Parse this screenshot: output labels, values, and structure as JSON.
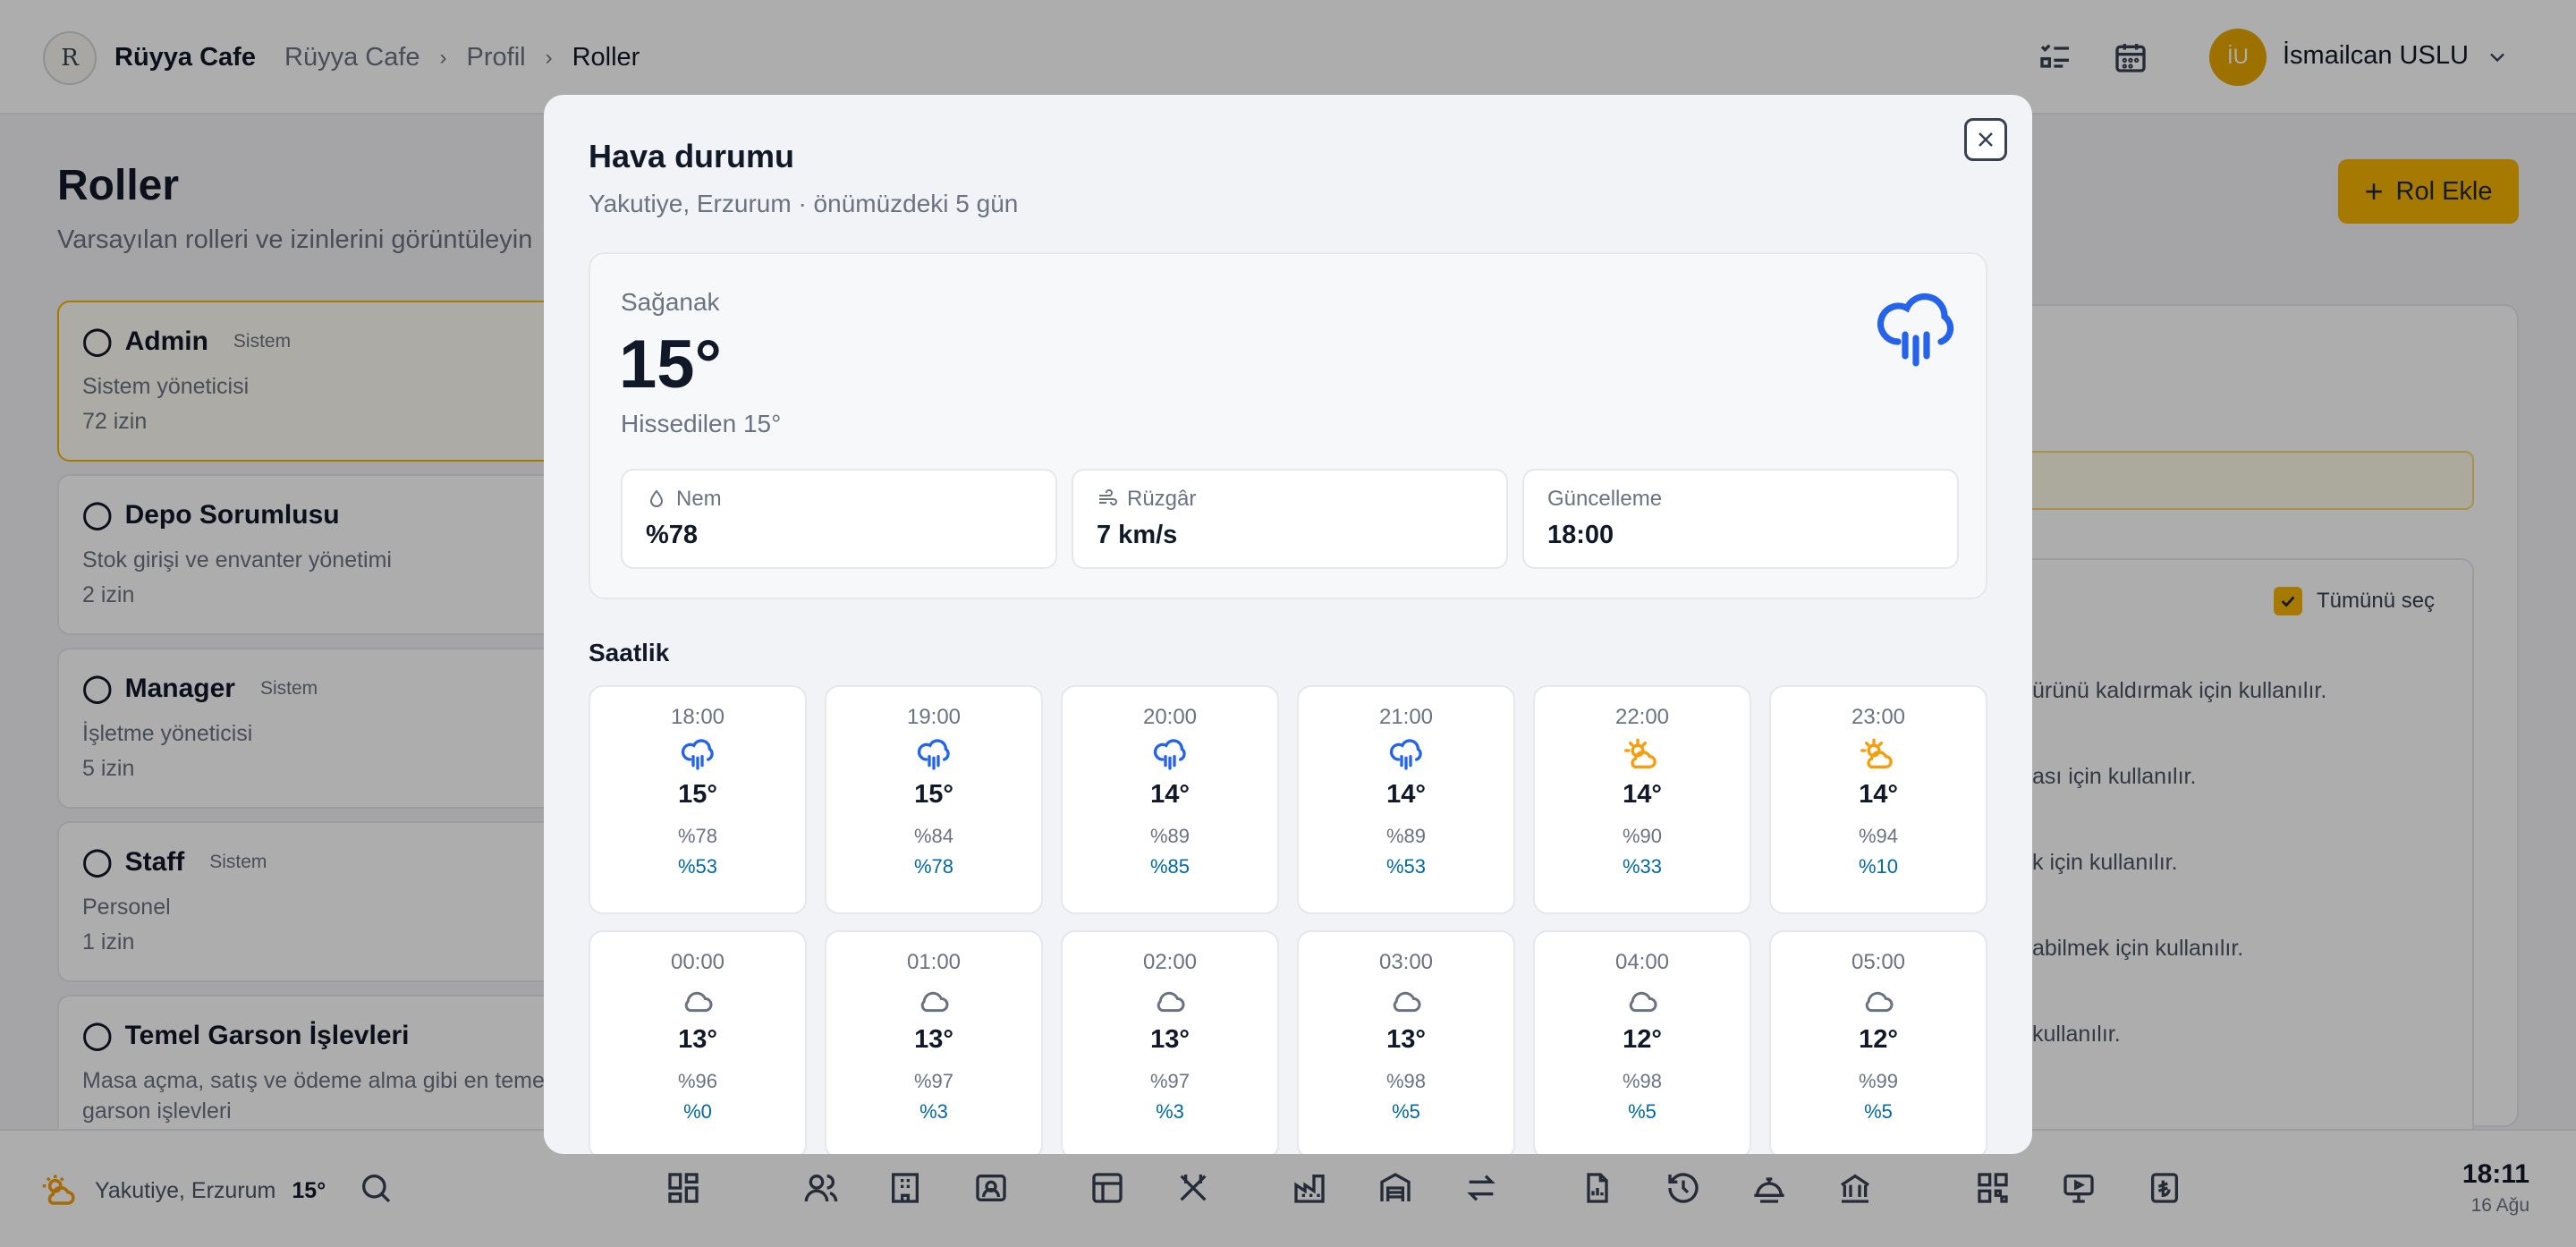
{
  "topbar": {
    "logo_text": "R",
    "brand": "Rüyya Cafe",
    "breadcrumb": [
      "Rüyya Cafe",
      "Profil",
      "Roller"
    ],
    "user_initials": "İU",
    "user_name": "İsmailcan USLU"
  },
  "page": {
    "title": "Roller",
    "subtitle": "Varsayılan rolleri ve izinlerini görüntüleyin",
    "add_button": "Rol Ekle"
  },
  "roles": [
    {
      "name": "Admin",
      "tag": "Sistem",
      "desc": "Sistem yöneticisi",
      "count": "72 izin"
    },
    {
      "name": "Depo Sorumlusu",
      "tag": "",
      "desc": "Stok girişi ve envanter yönetimi",
      "count": "2 izin"
    },
    {
      "name": "Manager",
      "tag": "Sistem",
      "desc": "İşletme yöneticisi",
      "count": "5 izin"
    },
    {
      "name": "Staff",
      "tag": "Sistem",
      "desc": "Personel",
      "count": "1 izin"
    },
    {
      "name": "Temel Garson İşlevleri",
      "tag": "",
      "desc": "Masa açma, satış ve ödeme alma gibi en temel garson işlevleri",
      "count": ""
    }
  ],
  "permissions_panel": {
    "select_all": "Tümünü seç",
    "items": [
      "ürünü kaldırmak için kullanılır.",
      "ası için kullanılır.",
      "k için kullanılır.",
      "abilmek için kullanılır.",
      "kullanılır."
    ]
  },
  "bottombar": {
    "location": "Yakutiye, Erzurum",
    "temp": "15°",
    "time": "18:11",
    "date": "16 Ağu"
  },
  "modal": {
    "title": "Hava durumu",
    "subtitle": "Yakutiye, Erzurum · önümüzdeki 5 gün",
    "current": {
      "condition": "Sağanak",
      "temp": "15°",
      "feels_like": "Hissedilen 15°",
      "icon": "rain-cloud-icon"
    },
    "stats": [
      {
        "label": "Nem",
        "value": "%78",
        "icon": "humidity-icon"
      },
      {
        "label": "Rüzgâr",
        "value": "7 km/s",
        "icon": "wind-icon"
      },
      {
        "label": "Güncelleme",
        "value": "18:00",
        "icon": ""
      }
    ],
    "hourly_title": "Saatlik",
    "hourly": [
      {
        "time": "18:00",
        "icon": "rain",
        "temp": "15°",
        "humidity": "%78",
        "precip": "%53"
      },
      {
        "time": "19:00",
        "icon": "rain",
        "temp": "15°",
        "humidity": "%84",
        "precip": "%78"
      },
      {
        "time": "20:00",
        "icon": "rain",
        "temp": "14°",
        "humidity": "%89",
        "precip": "%85"
      },
      {
        "time": "21:00",
        "icon": "rain",
        "temp": "14°",
        "humidity": "%89",
        "precip": "%53"
      },
      {
        "time": "22:00",
        "icon": "partly-cloudy",
        "temp": "14°",
        "humidity": "%90",
        "precip": "%33"
      },
      {
        "time": "23:00",
        "icon": "partly-cloudy",
        "temp": "14°",
        "humidity": "%94",
        "precip": "%10"
      },
      {
        "time": "00:00",
        "icon": "cloud",
        "temp": "13°",
        "humidity": "%96",
        "precip": "%0"
      },
      {
        "time": "01:00",
        "icon": "cloud",
        "temp": "13°",
        "humidity": "%97",
        "precip": "%3"
      },
      {
        "time": "02:00",
        "icon": "cloud",
        "temp": "13°",
        "humidity": "%97",
        "precip": "%3"
      },
      {
        "time": "03:00",
        "icon": "cloud",
        "temp": "13°",
        "humidity": "%98",
        "precip": "%5"
      },
      {
        "time": "04:00",
        "icon": "cloud",
        "temp": "12°",
        "humidity": "%98",
        "precip": "%5"
      },
      {
        "time": "05:00",
        "icon": "cloud",
        "temp": "12°",
        "humidity": "%99",
        "precip": "%5"
      }
    ]
  },
  "colors": {
    "accent": "#f5b400",
    "rain_icon": "#2563eb",
    "sun_icon": "#f59e0b",
    "precip_text": "#0369a1"
  }
}
